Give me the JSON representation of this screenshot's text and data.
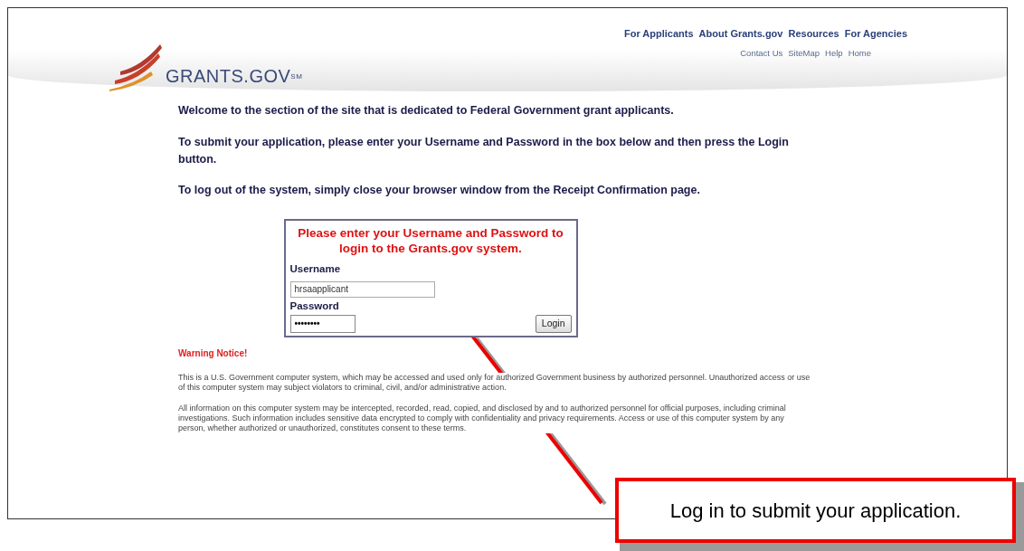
{
  "header": {
    "logo_text": "GRANTS.GOV",
    "logo_mark": "SM",
    "main_nav": [
      "For Applicants",
      "About Grants.gov",
      "Resources",
      "For Agencies"
    ],
    "sub_nav": [
      "Contact Us",
      "SiteMap",
      "Help",
      "Home"
    ]
  },
  "intro": [
    "Welcome to the section of the site that is dedicated to Federal Government grant applicants.",
    "To submit your application, please enter your Username and Password in the box below and then press the Login button.",
    "To log out of the system, simply close your browser window from the Receipt Confirmation page."
  ],
  "login": {
    "heading": "Please enter your Username and Password to login to the Grants.gov system.",
    "username_label": "Username",
    "username_value": "hrsaapplicant",
    "password_label": "Password",
    "password_value": "••••••••",
    "button": "Login"
  },
  "warning": {
    "title": "Warning Notice!",
    "paragraphs": [
      "This is a U.S. Government computer system, which may be accessed and used only for authorized Government business by authorized personnel. Unauthorized access or use of this computer system may subject violators to criminal, civil, and/or administrative action.",
      "All information on this computer system may be intercepted, recorded, read, copied, and disclosed by and to authorized personnel for official purposes, including criminal investigations. Such information includes sensitive data encrypted to comply with confidentiality and privacy requirements. Access or use of this computer system by any person, whether authorized or unauthorized, constitutes consent to these terms."
    ]
  },
  "callout": {
    "text": "Log in to submit your application."
  }
}
